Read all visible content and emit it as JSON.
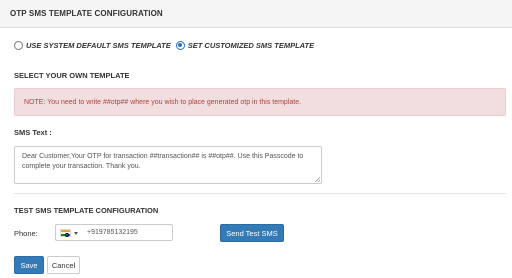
{
  "header": {
    "title": "OTP SMS TEMPLATE CONFIGURATION"
  },
  "template_choice": {
    "options": [
      {
        "label": "USE SYSTEM DEFAULT SMS TEMPLATE",
        "selected": false
      },
      {
        "label": "SET CUSTOMIZED SMS TEMPLATE",
        "selected": true
      }
    ]
  },
  "custom_section": {
    "title": "SELECT YOUR OWN TEMPLATE",
    "note": "NOTE: You need to write ##otp## where you wish to place generated otp in this template.",
    "sms_label": "SMS Text :",
    "sms_value": "Dear Customer,Your OTP for transaction ##transaction## is ##otp##. Use this Passcode to complete your transaction. Thank you."
  },
  "test_section": {
    "title": "TEST SMS TEMPLATE CONFIGURATION",
    "phone_label": "Phone:",
    "country_flag": "india-flag",
    "phone_value": "+919785132195",
    "send_button": "Send Test SMS"
  },
  "actions": {
    "save": "Save",
    "cancel": "Cancel"
  },
  "colors": {
    "primary": "#337ab7",
    "note_bg": "#f2dede",
    "note_text": "#a94442",
    "header_bg": "#f5f5f5"
  }
}
